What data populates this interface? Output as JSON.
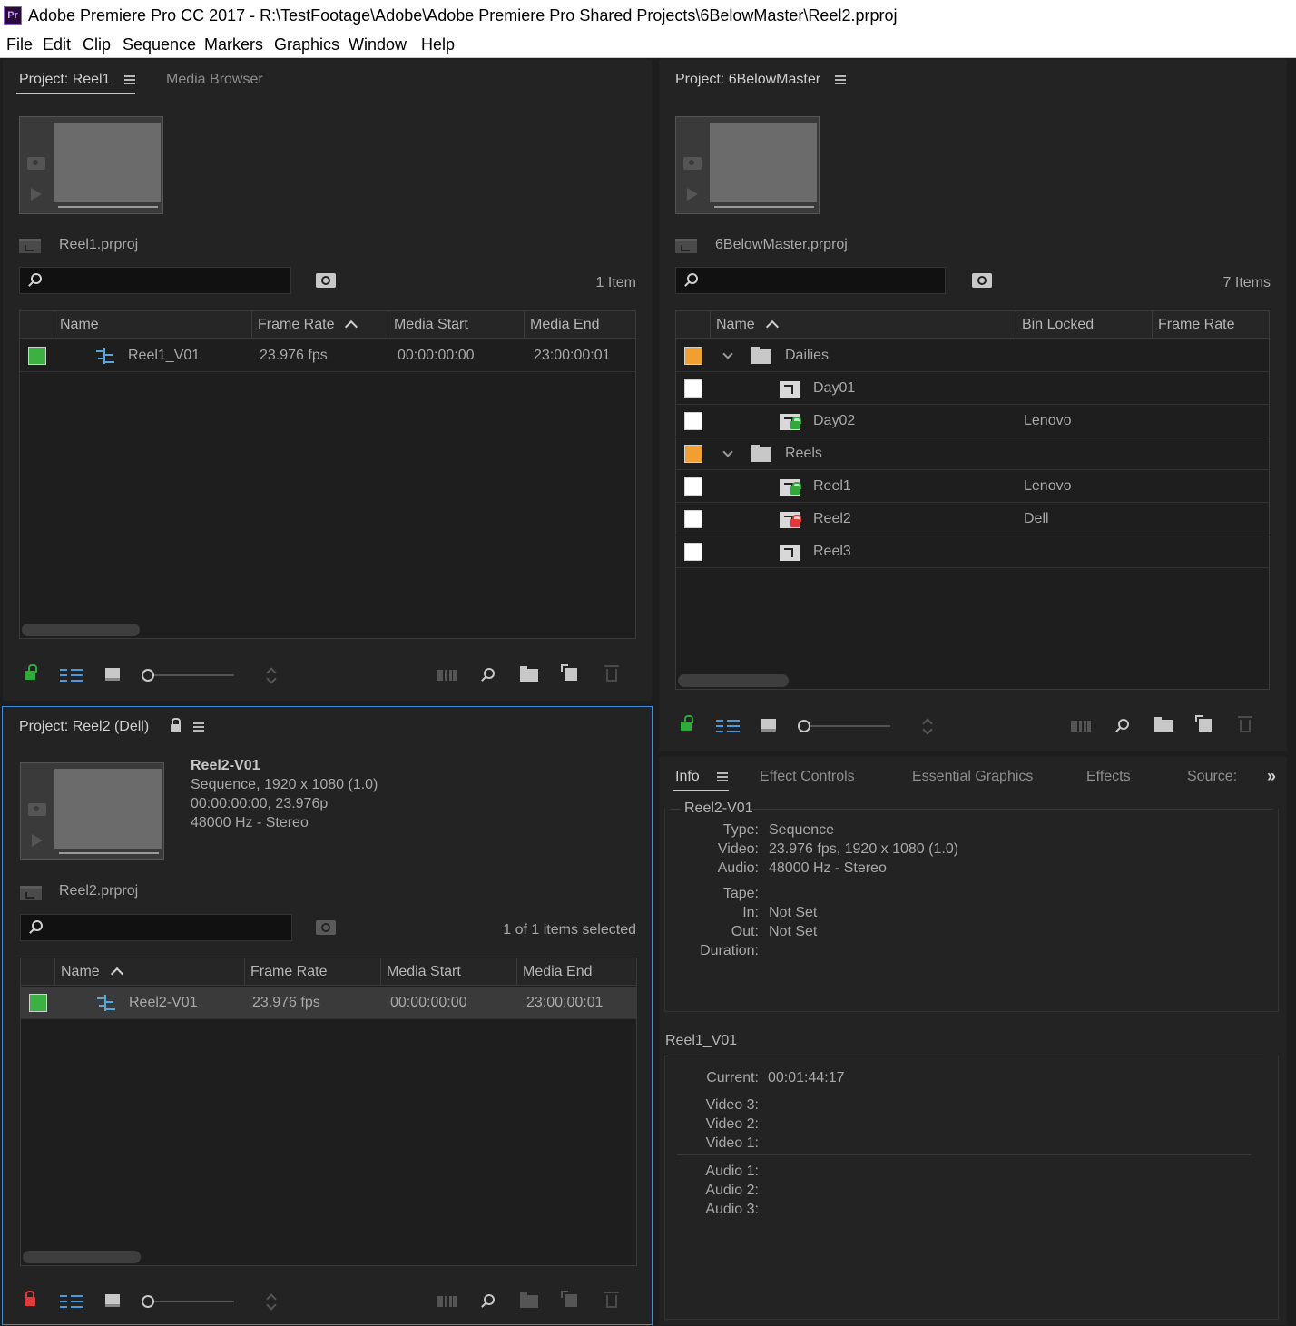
{
  "window": {
    "app_icon": "Pr",
    "title": "Adobe Premiere Pro CC 2017 - R:\\TestFootage\\Adobe\\Adobe Premiere Pro Shared Projects\\6BelowMaster\\Reel2.prproj"
  },
  "menu": [
    "File",
    "Edit",
    "Clip",
    "Sequence",
    "Markers",
    "Graphics",
    "Window",
    "Help"
  ],
  "reel1_panel": {
    "tab_project": "Project: Reel1",
    "tab_media_browser": "Media Browser",
    "project_file": "Reel1.prproj",
    "item_count": "1 Item",
    "columns": [
      "Name",
      "Frame Rate",
      "Media Start",
      "Media End"
    ],
    "rows": [
      {
        "label_color": "#3cb043",
        "name": "Reel1_V01",
        "frame_rate": "23.976 fps",
        "media_start": "00:00:00:00",
        "media_end": "23:00:00:01"
      }
    ]
  },
  "master_panel": {
    "tab_project": "Project: 6BelowMaster",
    "project_file": "6BelowMaster.prproj",
    "item_count": "7 Items",
    "columns": [
      "Name",
      "Bin Locked",
      "Frame Rate"
    ],
    "rows": [
      {
        "label_color": "#f0a030",
        "name": "Dailies",
        "bin_locked": "",
        "type": "folder",
        "lock": "none"
      },
      {
        "label_color": "#ffffff",
        "name": "Day01",
        "bin_locked": "",
        "type": "shared",
        "lock": "none"
      },
      {
        "label_color": "#ffffff",
        "name": "Day02",
        "bin_locked": "Lenovo",
        "type": "shared",
        "lock": "green"
      },
      {
        "label_color": "#f0a030",
        "name": "Reels",
        "bin_locked": "",
        "type": "folder",
        "lock": "none"
      },
      {
        "label_color": "#ffffff",
        "name": "Reel1",
        "bin_locked": "Lenovo",
        "type": "shared",
        "lock": "green"
      },
      {
        "label_color": "#ffffff",
        "name": "Reel2",
        "bin_locked": "Dell",
        "type": "shared",
        "lock": "red"
      },
      {
        "label_color": "#ffffff",
        "name": "Reel3",
        "bin_locked": "",
        "type": "shared",
        "lock": "none"
      }
    ]
  },
  "reel2_panel": {
    "tab_project": "Project: Reel2 (Dell)",
    "clip_name": "Reel2-V01",
    "clip_line1": "Sequence, 1920 x 1080 (1.0)",
    "clip_line2": "00:00:00:00, 23.976p",
    "clip_line3": "48000 Hz - Stereo",
    "project_file": "Reel2.prproj",
    "item_count": "1 of 1 items selected",
    "columns": [
      "Name",
      "Frame Rate",
      "Media Start",
      "Media End"
    ],
    "rows": [
      {
        "label_color": "#3cb043",
        "name": "Reel2-V01",
        "frame_rate": "23.976 fps",
        "media_start": "00:00:00:00",
        "media_end": "23:00:00:01"
      }
    ]
  },
  "info_panel": {
    "tabs": [
      "Info",
      "Effect Controls",
      "Essential Graphics",
      "Effects",
      "Source:"
    ],
    "section1_title": "Reel2-V01",
    "fields": [
      {
        "label": "Type:",
        "value": "Sequence"
      },
      {
        "label": "Video:",
        "value": "23.976 fps, 1920 x 1080 (1.0)"
      },
      {
        "label": "Audio:",
        "value": "48000 Hz - Stereo"
      },
      {
        "label": "Tape:",
        "value": ""
      },
      {
        "label": "In:",
        "value": "Not Set"
      },
      {
        "label": "Out:",
        "value": "Not Set"
      },
      {
        "label": "Duration:",
        "value": ""
      }
    ],
    "section2_title": "Reel1_V01",
    "current_label": "Current:",
    "current_value": "00:01:44:17",
    "video_tracks": [
      "Video 3:",
      "Video 2:",
      "Video 1:"
    ],
    "audio_tracks": [
      "Audio 1:",
      "Audio 2:",
      "Audio 3:"
    ]
  }
}
